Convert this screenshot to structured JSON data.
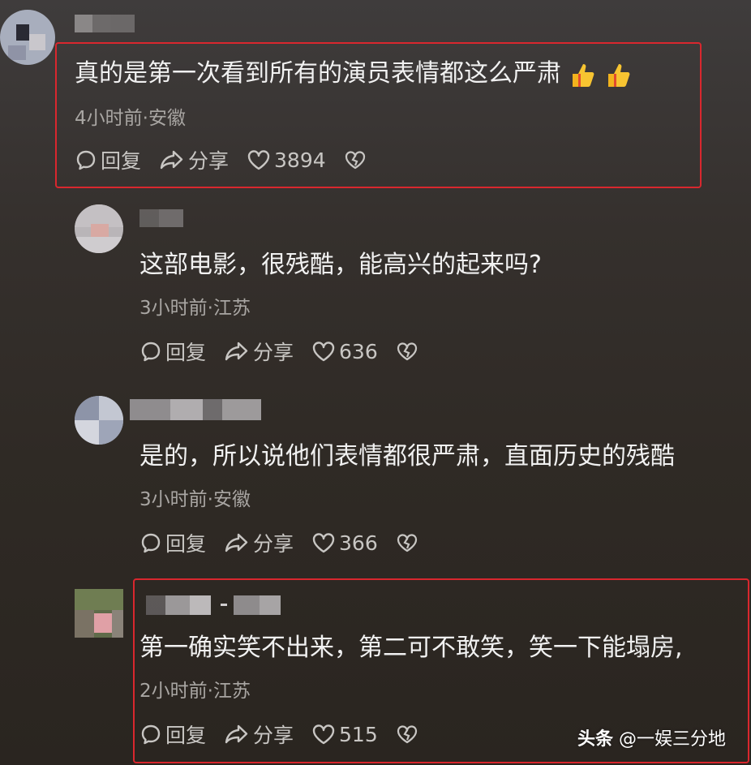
{
  "actions": {
    "reply_label": "回复",
    "share_label": "分享"
  },
  "comments": [
    {
      "text": "真的是第一次看到所有的演员表情都这么严肃",
      "emoji": "👍 👍",
      "meta": "4小时前·安徽",
      "likes": "3894"
    },
    {
      "text": "这部电影，很残酷，能高兴的起来吗?",
      "meta": "3小时前·江苏",
      "likes": "636"
    },
    {
      "text": "是的，所以说他们表情都很严肃，直面历史的残酷",
      "meta": "3小时前·安徽",
      "likes": "366"
    },
    {
      "text": "第一确实笑不出来，第二可不敢笑，笑一下能塌房,",
      "meta": "2小时前·江苏",
      "likes": "515"
    }
  ],
  "watermark": {
    "brand": "头条",
    "account": "@一娱三分地"
  },
  "colors": {
    "highlight_border": "#d9272e",
    "background": "#35302d",
    "meta_text": "#a9a6a3"
  }
}
